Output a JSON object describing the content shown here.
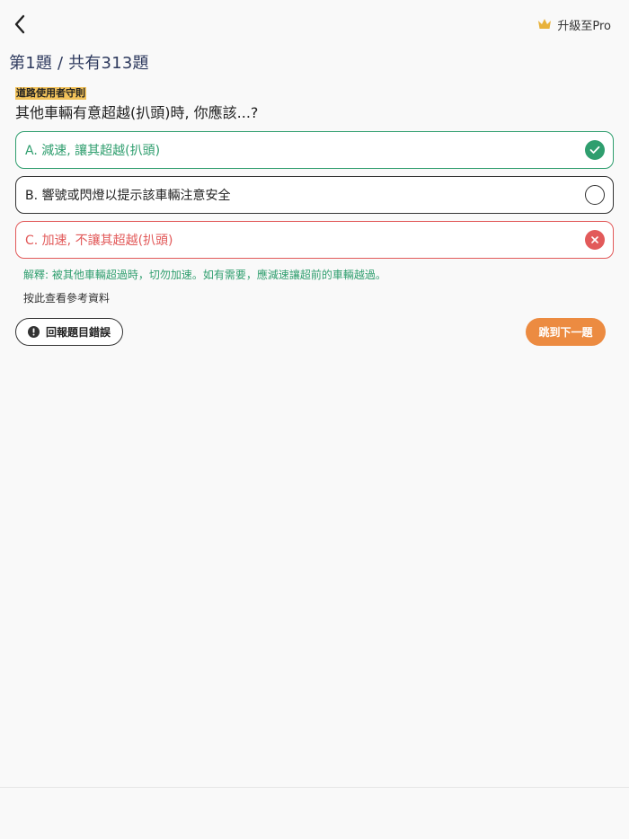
{
  "header": {
    "upgrade_label": "升級至Pro"
  },
  "progress": {
    "title": "第1題 / 共有313題"
  },
  "question": {
    "category": "道路使用者守則",
    "text": "其他車輛有意超越(扒頭)時, 你應該...?"
  },
  "options": [
    {
      "label": "A. 減速, 讓其超越(扒頭)",
      "state": "correct"
    },
    {
      "label": "B. 響號或閃燈以提示該車輛注意安全",
      "state": "unselected"
    },
    {
      "label": "C. 加速, 不讓其超越(扒頭)",
      "state": "wrong"
    }
  ],
  "explanation": {
    "text": "解釋: 被其他車輛超過時，切勿加速。如有需要，應減速讓超前的車輛越過。"
  },
  "reference": {
    "label": "按此查看參考資料"
  },
  "actions": {
    "report_label": "回報題目錯誤",
    "next_label": "跳到下一題"
  },
  "colors": {
    "correct": "#2f9e6e",
    "wrong": "#e25a5a",
    "accent": "#ec8b41",
    "tag": "#f2c25a",
    "title": "#2e3a5e"
  },
  "icons": {
    "back": "chevron-left-icon",
    "crown": "crown-icon",
    "correct": "check-icon",
    "wrong": "close-icon",
    "unselected": "empty-circle-icon",
    "report": "info-icon"
  }
}
